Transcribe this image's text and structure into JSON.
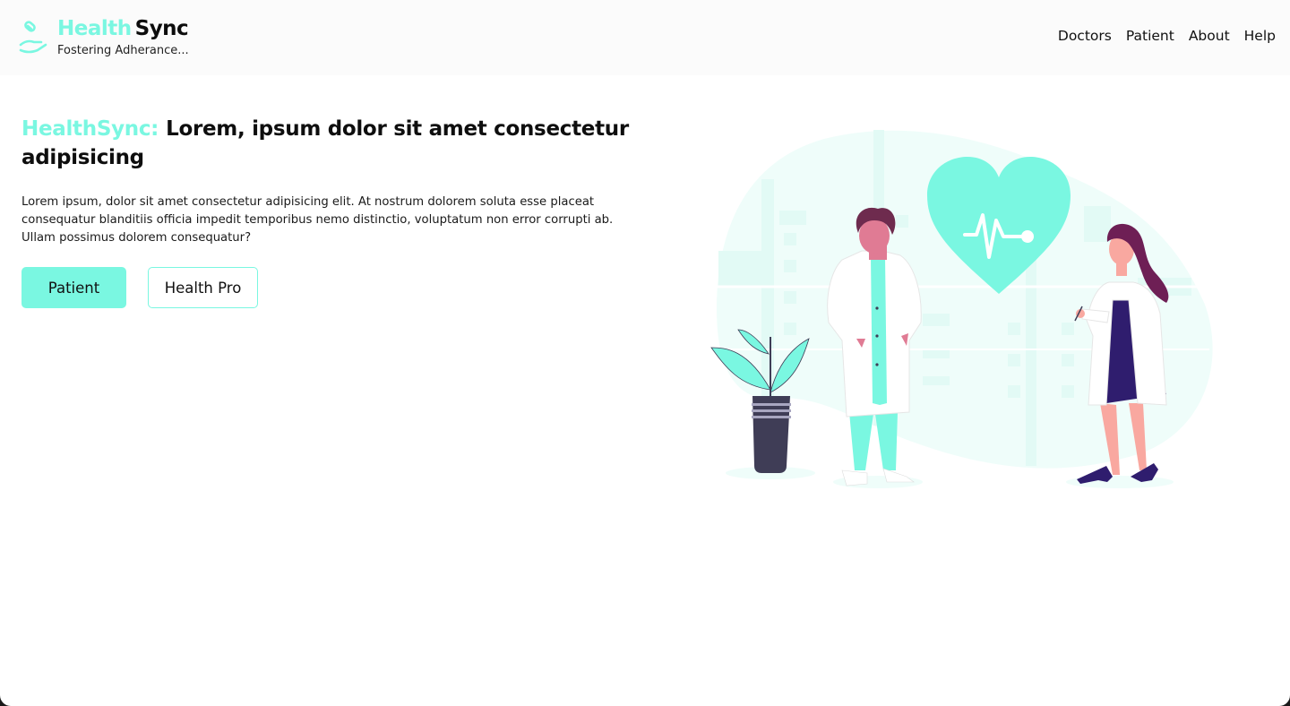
{
  "app": {
    "brand_accent": "Health",
    "brand_dark": "Sync",
    "tagline": "Fostering Adherance..."
  },
  "nav": {
    "items": [
      "Doctors",
      "Patient",
      "About",
      "Help"
    ]
  },
  "hero": {
    "title_accent": "HealthSync:",
    "title": "Lorem, ipsum dolor sit amet consectetur adipisicing",
    "description": "Lorem ipsum, dolor sit amet consectetur adipisicing elit. At nostrum dolorem soluta esse placeat consequatur blanditiis officia impedit temporibus nemo distinctio, voluptatum non error corrupti ab. Ullam possimus dolorem consequatur?",
    "primary_button": "Patient",
    "secondary_button": "Health Pro"
  },
  "colors": {
    "accent": "#7af7e1",
    "text": "#111111",
    "navbar_bg": "#fbfbfb"
  },
  "icons": {
    "logo": "hand-pill-icon",
    "illustration": "doctors-heart-illustration"
  }
}
